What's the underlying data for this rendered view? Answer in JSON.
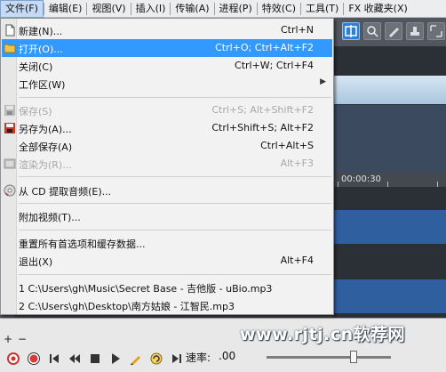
{
  "menubar": {
    "items": [
      {
        "label": "文件(F)"
      },
      {
        "label": "编辑(E)"
      },
      {
        "label": "视图(V)"
      },
      {
        "label": "插入(I)"
      },
      {
        "label": "传输(A)"
      },
      {
        "label": "进程(P)"
      },
      {
        "label": "特效(C)"
      },
      {
        "label": "工具(T)"
      },
      {
        "label": "FX 收藏夹(X)"
      }
    ]
  },
  "file_menu": {
    "new": {
      "label": "新建(N)...",
      "shortcut": "Ctrl+N",
      "icon": "new-file-icon"
    },
    "open": {
      "label": "打开(O)...",
      "shortcut": "Ctrl+O; Ctrl+Alt+F2",
      "icon": "folder-open-icon"
    },
    "close": {
      "label": "关闭(C)",
      "shortcut": "Ctrl+W; Ctrl+F4"
    },
    "workspace": {
      "label": "工作区(W)"
    },
    "save": {
      "label": "保存(S)",
      "shortcut": "Ctrl+S; Alt+Shift+F2",
      "icon": "save-icon",
      "disabled": true
    },
    "save_as": {
      "label": "另存为(A)...",
      "shortcut": "Ctrl+Shift+S; Alt+F2",
      "icon": "save-as-icon"
    },
    "save_all": {
      "label": "全部保存(A)",
      "shortcut": "Ctrl+Alt+S"
    },
    "render_as": {
      "label": "渲染为(R)...",
      "shortcut": "Alt+F3",
      "icon": "render-icon",
      "disabled": true
    },
    "extract_cd": {
      "label": "从 CD 提取音频(E)...",
      "icon": "cd-icon"
    },
    "attach_video": {
      "label": "附加视频(T)..."
    },
    "reset_prefs": {
      "label": "重置所有首选项和缓存数据..."
    },
    "exit": {
      "label": "退出(X)",
      "shortcut": "Alt+F4"
    },
    "recent": [
      {
        "label": "1 C:\\Users\\gh\\Music\\Secret Base - 吉他版 - uBio.mp3"
      },
      {
        "label": "2 C:\\Users\\gh\\Desktop\\南方姑娘 - 江智民.mp3"
      }
    ]
  },
  "timeline": {
    "time_label": "00:00:30"
  },
  "transport": {
    "rate_label": "速率:",
    "rate_value": ".00",
    "plus": "+",
    "minus": "−",
    "icons": [
      "record-arm-icon",
      "record-icon",
      "go-to-start-icon",
      "rewind-icon",
      "stop-icon",
      "play-icon",
      "edit-pen-icon",
      "loop-icon",
      "go-to-end-icon"
    ]
  },
  "watermark": {
    "text": "www.rjtj.cn软荐网"
  },
  "colors": {
    "highlight": "#3399ff",
    "menubar_bg": "#ecedee",
    "menu_bg": "#f2f2f2",
    "record_red": "#d83a3a"
  }
}
